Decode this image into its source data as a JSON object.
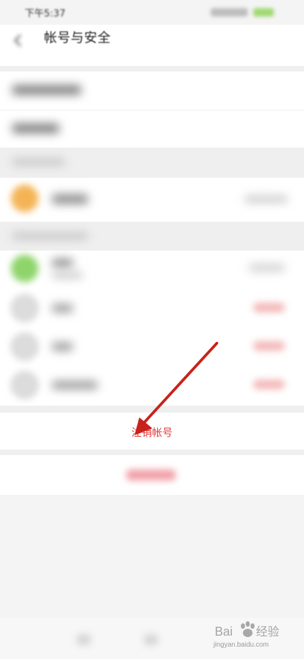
{
  "status_bar": {
    "time": "下午5:37"
  },
  "header": {
    "title": "帐号与安全"
  },
  "actions": {
    "cancel_account": "注销帐号"
  },
  "watermark": {
    "brand": "Bai 经验",
    "url": "jingyan.baidu.com"
  },
  "colors": {
    "accent_red": "#e0373b",
    "annotation_arrow": "#c8221b",
    "avatar_orange": "#f4b455",
    "avatar_green": "#8ed46a"
  },
  "icons": {
    "back": "back-arrow-icon",
    "paw": "baidu-paw-icon"
  }
}
